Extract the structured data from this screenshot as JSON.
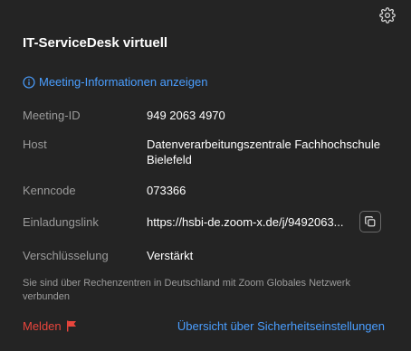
{
  "meeting": {
    "title": "IT-ServiceDesk virtuell",
    "show_info_label": "Meeting-Informationen anzeigen"
  },
  "details": {
    "meeting_id_label": "Meeting-ID",
    "meeting_id_value": "949 2063 4970",
    "host_label": "Host",
    "host_value_line1": "Datenverarbeitungszentrale Fachhochschule",
    "host_value_line2": "Bielefeld",
    "passcode_label": "Kenncode",
    "passcode_value": "073366",
    "invite_label": "Einladungslink",
    "invite_value": "https://hsbi-de.zoom-x.de/j/9492063...",
    "encryption_label": "Verschlüsselung",
    "encryption_value": "Verstärkt"
  },
  "footer": {
    "note": "Sie sind über Rechenzentren in Deutschland mit Zoom Globales Netzwerk verbunden",
    "report_label": "Melden",
    "security_link": "Übersicht über Sicherheitseinstellungen"
  },
  "icons": {
    "settings": "gear-icon",
    "info": "info-circle-icon",
    "copy": "copy-icon",
    "report": "flag-icon"
  },
  "colors": {
    "background": "#242424",
    "link": "#4a9eff",
    "report": "#e8453c",
    "label": "#9b9b9b",
    "value": "#ffffff"
  }
}
